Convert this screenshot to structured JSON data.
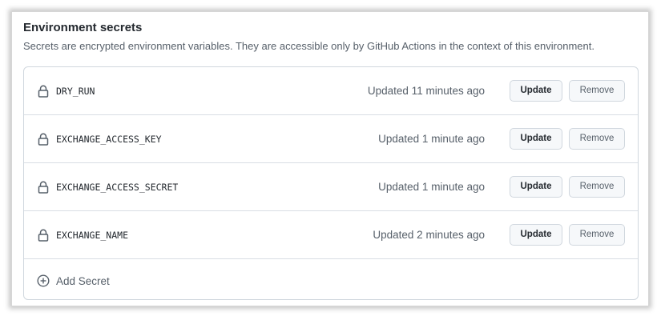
{
  "section": {
    "title": "Environment secrets",
    "description": "Secrets are encrypted environment variables. They are accessible only by GitHub Actions in the context of this environment."
  },
  "secrets": [
    {
      "name": "DRY_RUN",
      "updated": "Updated 11 minutes ago",
      "update_label": "Update",
      "remove_label": "Remove"
    },
    {
      "name": "EXCHANGE_ACCESS_KEY",
      "updated": "Updated 1 minute ago",
      "update_label": "Update",
      "remove_label": "Remove"
    },
    {
      "name": "EXCHANGE_ACCESS_SECRET",
      "updated": "Updated 1 minute ago",
      "update_label": "Update",
      "remove_label": "Remove"
    },
    {
      "name": "EXCHANGE_NAME",
      "updated": "Updated 2 minutes ago",
      "update_label": "Update",
      "remove_label": "Remove"
    }
  ],
  "add_secret": {
    "label": "Add Secret",
    "icon": "plus-circle-icon"
  },
  "icons": {
    "secret_row": "lock-icon"
  },
  "colors": {
    "text_primary": "#24292f",
    "text_muted": "#57606a",
    "border": "#d0d7de",
    "button_bg": "#f6f8fa"
  }
}
